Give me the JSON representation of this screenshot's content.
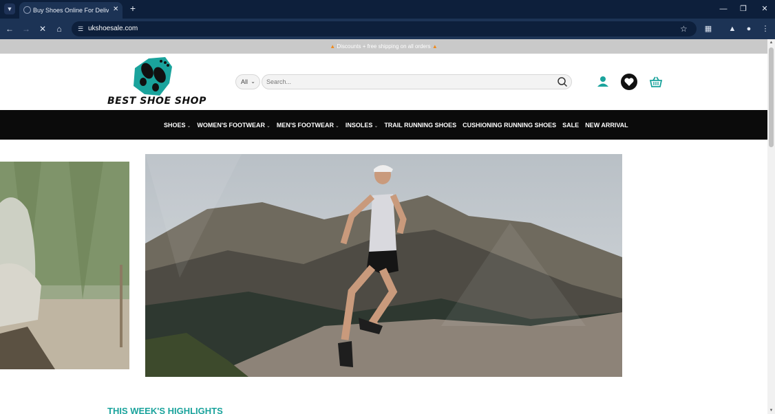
{
  "browser": {
    "tab_title": "Buy Shoes Online For Delivery /",
    "url": "ukshoesale.com",
    "icons": {
      "tab_menu": "chevron-down-icon",
      "new_tab": "plus-icon",
      "back": "arrow-left-icon",
      "forward": "arrow-right-icon",
      "stop": "close-icon",
      "home": "home-icon",
      "bookmark": "star-icon",
      "extensions": "puzzle-icon",
      "labs": "flask-icon",
      "profile": "user-icon",
      "menu": "more-vertical-icon"
    }
  },
  "promo": {
    "text": "Discounts + free shipping on all orders"
  },
  "header": {
    "logo_text": "BEST SHOE SHOP",
    "search_category": "All",
    "search_placeholder": "Search...",
    "accent_color": "#1aa39c"
  },
  "nav": {
    "items": [
      {
        "label": "SHOES",
        "dropdown": true
      },
      {
        "label": "WOMEN'S FOOTWEAR",
        "dropdown": true
      },
      {
        "label": "MEN'S FOOTWEAR",
        "dropdown": true
      },
      {
        "label": "INSOLES",
        "dropdown": true
      },
      {
        "label": "TRAIL RUNNING SHOES",
        "dropdown": false
      },
      {
        "label": "CUSHIONING RUNNING SHOES",
        "dropdown": false
      },
      {
        "label": "SALE",
        "dropdown": false
      },
      {
        "label": "NEW ARRIVAL",
        "dropdown": false
      }
    ]
  },
  "content": {
    "section_heading": "THIS WEEK'S HIGHLIGHTS"
  }
}
